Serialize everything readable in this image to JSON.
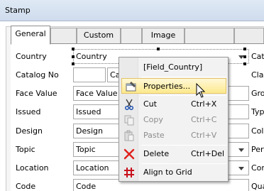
{
  "window": {
    "title": "Stamp"
  },
  "tabs": [
    "General",
    "Custom",
    "Image"
  ],
  "form": {
    "rows": [
      {
        "label": "Country",
        "value": "Country",
        "combo": true,
        "right_label": "Cat"
      },
      {
        "label": "Catalog No",
        "value": "Ca",
        "combo": false,
        "right_label": "Clas"
      },
      {
        "label": "Face Value",
        "value": "Face Value",
        "combo": false,
        "right_label": "Gro"
      },
      {
        "label": "Issued",
        "value": "Issued",
        "combo": false,
        "right_label": "Typ"
      },
      {
        "label": "Design",
        "value": "Design",
        "combo": false,
        "right_label": "Col"
      },
      {
        "label": "Topic",
        "value": "Topic",
        "combo": true,
        "right_label": "Perf"
      },
      {
        "label": "Location",
        "value": "Location",
        "combo": true,
        "right_label": "Con"
      },
      {
        "label": "Code",
        "value": "Code",
        "combo": false,
        "right_label": "Qua"
      }
    ]
  },
  "context_menu": {
    "header": "[Field_Country]",
    "items": [
      {
        "label": "Properties...",
        "shortcut": "",
        "icon": "properties-icon",
        "highlighted": true,
        "disabled": false
      },
      {
        "label": "Cut",
        "shortcut": "Ctrl+X",
        "icon": "scissors-icon",
        "highlighted": false,
        "disabled": false
      },
      {
        "label": "Copy",
        "shortcut": "Ctrl+C",
        "icon": "copy-icon",
        "highlighted": false,
        "disabled": true
      },
      {
        "label": "Paste",
        "shortcut": "Ctrl+V",
        "icon": "paste-icon",
        "highlighted": false,
        "disabled": true
      },
      {
        "label": "Delete",
        "shortcut": "Ctrl+Del",
        "icon": "delete-x-icon",
        "highlighted": false,
        "disabled": false
      },
      {
        "label": "Align to Grid",
        "shortcut": "",
        "icon": "grid-icon",
        "highlighted": false,
        "disabled": false
      }
    ]
  },
  "colors": {
    "highlight": "#fce98d",
    "delete_icon": "#e0201c",
    "grid_icon": "#c8101c"
  }
}
